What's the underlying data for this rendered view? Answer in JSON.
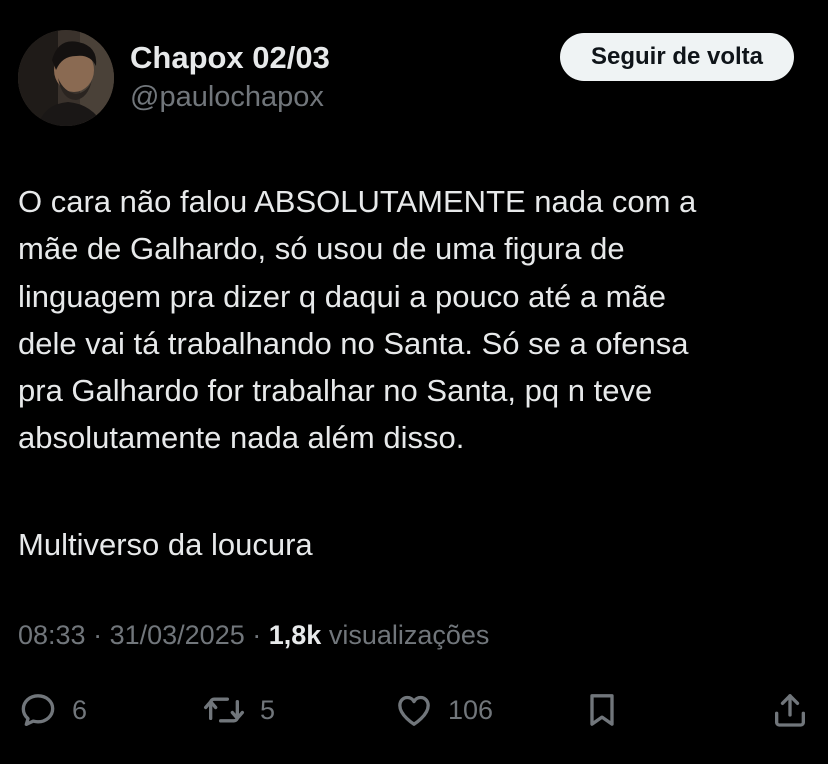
{
  "author": {
    "display_name": "Chapox 02/03",
    "handle": "@paulochapox",
    "avatar_icon": "user-photo-avatar"
  },
  "follow_button_label": "Seguir de volta",
  "tweet": {
    "text_lines": [
      "O cara não falou ABSOLUTAMENTE nada com a",
      "mãe de Galhardo, só usou de uma figura de",
      "linguagem pra dizer q daqui a pouco até a mãe",
      "dele vai tá trabalhando no Santa. Só se a ofensa",
      "pra Galhardo for trabalhar no Santa, pq n teve",
      "absolutamente nada além disso."
    ],
    "closing_line": "Multiverso da loucura"
  },
  "meta": {
    "time": "08:33",
    "separator": "·",
    "date": "31/03/2025",
    "views_count": "1,8k",
    "views_label": "visualizações"
  },
  "actions": {
    "replies": "6",
    "reposts": "5",
    "likes": "106"
  },
  "colors": {
    "background": "#000000",
    "primary_text": "#e7e9ea",
    "secondary_text": "#71767b",
    "button_bg": "#eff3f4",
    "button_text": "#0f1419"
  }
}
